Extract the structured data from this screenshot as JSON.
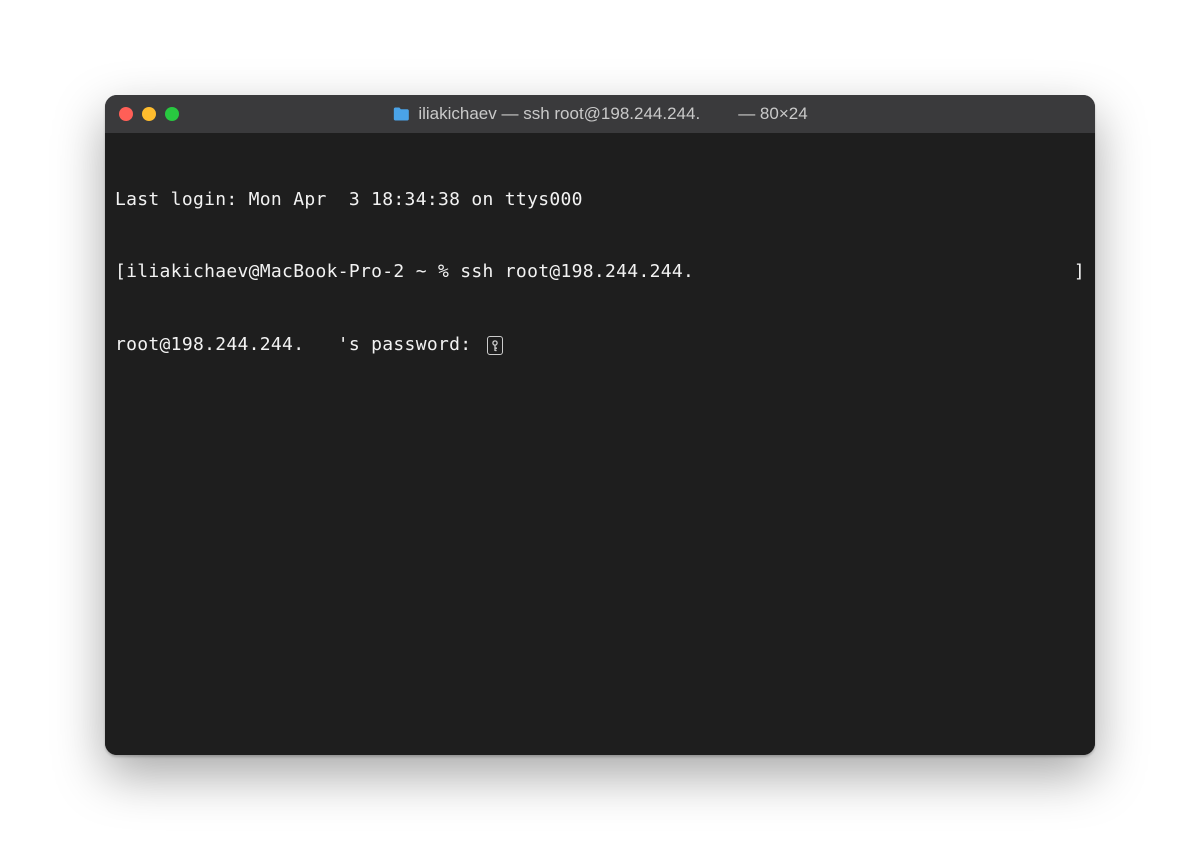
{
  "titlebar": {
    "folder_icon": "folder-icon",
    "title_main": "iliakichaev — ssh root@198.244.244.",
    "title_size": "— 80×24"
  },
  "terminal": {
    "line1": "Last login: Mon Apr  3 18:34:38 on ttys000",
    "line2_left_bracket": "[",
    "line2_prompt": "iliakichaev@MacBook-Pro-2 ~ % ssh root@198.244.244.",
    "line2_right_bracket": "]",
    "line3_text": "root@198.244.244.   's password: "
  }
}
